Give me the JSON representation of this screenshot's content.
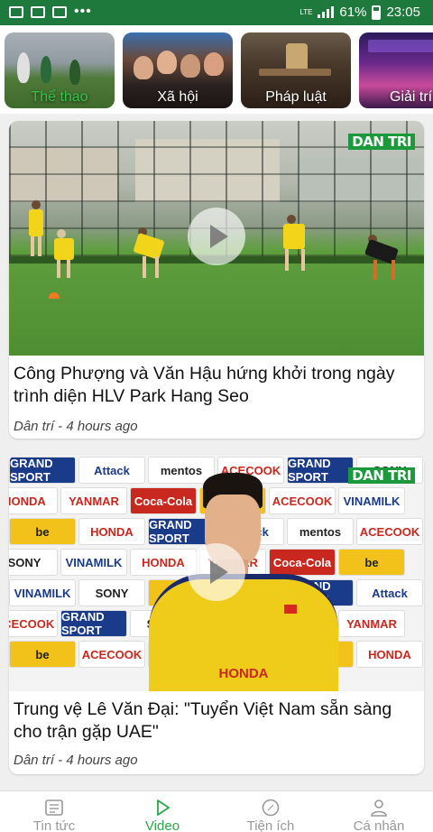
{
  "status_bar": {
    "battery": "61%",
    "time": "23:05",
    "network": "LTE"
  },
  "categories": [
    {
      "label": "Thể thao",
      "active": true
    },
    {
      "label": "Xã hội",
      "active": false
    },
    {
      "label": "Pháp luật",
      "active": false
    },
    {
      "label": "Giải trí",
      "active": false
    }
  ],
  "articles": [
    {
      "title": "Công Phượng và Văn Hậu hứng khởi trong ngày trình diện HLV Park Hang Seo",
      "source": "Dân trí",
      "time": "4 hours ago",
      "meta": "Dân trí - 4 hours ago",
      "logo": "DAN TRI"
    },
    {
      "title": "Trung vệ Lê Văn Đại: \"Tuyển Việt Nam sẵn sàng cho trận gặp UAE\"",
      "source": "Dân trí",
      "time": "4 hours ago",
      "meta": "Dân trí - 4 hours ago",
      "logo": "DAN TRI"
    }
  ],
  "sponsor_board": [
    "GRAND SPORT",
    "Attack",
    "mentos",
    "ACECOOK",
    "GRAND SPORT",
    "SONY",
    "VINAMILK",
    "HONDA",
    "YANMAR",
    "Coca-Cola",
    "be",
    "ACECOOK",
    "VINAMILK",
    "SONY",
    "be",
    "HONDA"
  ],
  "bottom_nav": [
    {
      "label": "Tin tức",
      "icon": "news-icon",
      "active": false
    },
    {
      "label": "Video",
      "icon": "play-icon",
      "active": true
    },
    {
      "label": "Tiện ích",
      "icon": "compass-icon",
      "active": false
    },
    {
      "label": "Cá nhân",
      "icon": "user-icon",
      "active": false
    }
  ],
  "colors": {
    "status_bar": "#1e7a3c",
    "accent": "#2aa84a",
    "active_category": "#37c24a"
  }
}
